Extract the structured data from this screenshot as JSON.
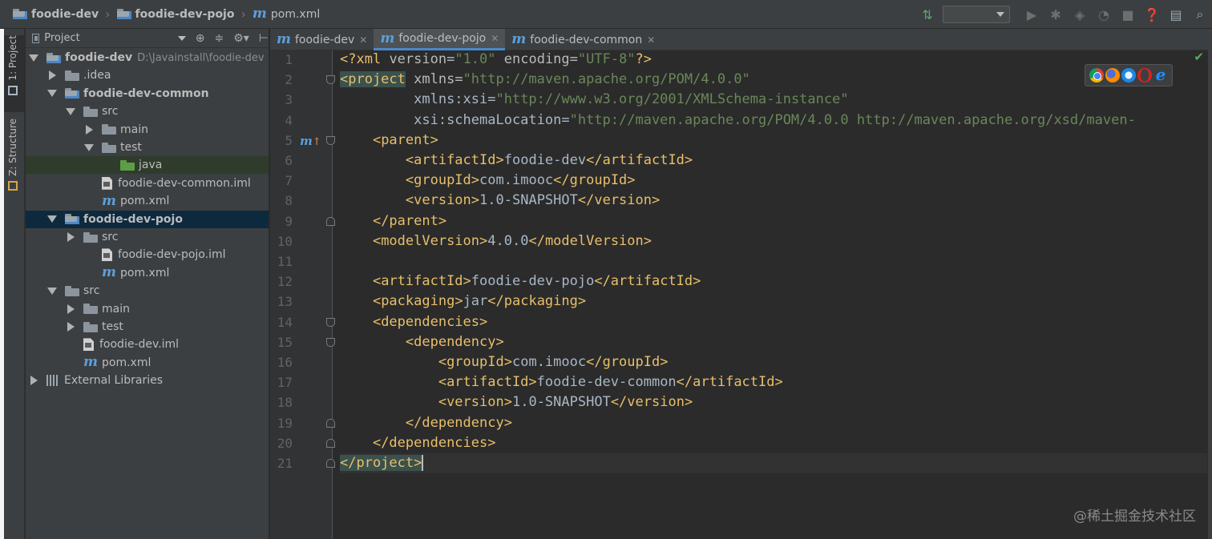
{
  "breadcrumbs": [
    "foodie-dev",
    "foodie-dev-pojo",
    "pom.xml"
  ],
  "project_panel": {
    "title": "Project",
    "tree": [
      {
        "label": "foodie-dev",
        "path": "D:\\Javainstall\\foodie-dev",
        "depth": 0,
        "expand": "down",
        "icon": "module-folder-icon",
        "bold": true
      },
      {
        "label": ".idea",
        "depth": 1,
        "expand": "right",
        "icon": "folder-icon"
      },
      {
        "label": "foodie-dev-common",
        "depth": 1,
        "expand": "down",
        "icon": "module-folder-icon",
        "bold": true
      },
      {
        "label": "src",
        "depth": 2,
        "expand": "down",
        "icon": "folder-icon"
      },
      {
        "label": "main",
        "depth": 3,
        "expand": "right",
        "icon": "folder-icon"
      },
      {
        "label": "test",
        "depth": 3,
        "expand": "down",
        "icon": "folder-icon"
      },
      {
        "label": "java",
        "depth": 4,
        "expand": "none",
        "icon": "test-folder-icon",
        "highlight": true
      },
      {
        "label": "foodie-dev-common.iml",
        "depth": 3,
        "expand": "none",
        "icon": "iml-file-icon"
      },
      {
        "label": "pom.xml",
        "depth": 3,
        "expand": "none",
        "icon": "maven-icon"
      },
      {
        "label": "foodie-dev-pojo",
        "depth": 1,
        "expand": "down",
        "icon": "module-folder-icon",
        "bold": true,
        "selected": true
      },
      {
        "label": "src",
        "depth": 2,
        "expand": "right",
        "icon": "folder-icon"
      },
      {
        "label": "foodie-dev-pojo.iml",
        "depth": 3,
        "expand": "none",
        "icon": "iml-file-icon"
      },
      {
        "label": "pom.xml",
        "depth": 3,
        "expand": "none",
        "icon": "maven-icon"
      },
      {
        "label": "src",
        "depth": 1,
        "expand": "down",
        "icon": "folder-icon"
      },
      {
        "label": "main",
        "depth": 2,
        "expand": "right",
        "icon": "folder-icon"
      },
      {
        "label": "test",
        "depth": 2,
        "expand": "right",
        "icon": "folder-icon"
      },
      {
        "label": "foodie-dev.iml",
        "depth": 2,
        "expand": "none",
        "icon": "iml-file-icon"
      },
      {
        "label": "pom.xml",
        "depth": 2,
        "expand": "none",
        "icon": "maven-icon"
      },
      {
        "label": "External Libraries",
        "depth": 0,
        "expand": "right",
        "icon": "library-icon"
      }
    ]
  },
  "stripe": {
    "project_label": "1: Project",
    "structure_label": "Z: Structure"
  },
  "tabs": [
    {
      "label": "foodie-dev",
      "active": false
    },
    {
      "label": "foodie-dev-pojo",
      "active": true
    },
    {
      "label": "foodie-dev-common",
      "active": false
    }
  ],
  "editor": {
    "line_numbers": [
      "1",
      "2",
      "3",
      "4",
      "5",
      "6",
      "7",
      "8",
      "9",
      "10",
      "11",
      "12",
      "13",
      "14",
      "15",
      "16",
      "17",
      "18",
      "19",
      "20",
      "21"
    ],
    "lines": [
      "<?xml version=\"1.0\" encoding=\"UTF-8\"?>",
      "<project xmlns=\"http://maven.apache.org/POM/4.0.0\"",
      "         xmlns:xsi=\"http://www.w3.org/2001/XMLSchema-instance\"",
      "         xsi:schemaLocation=\"http://maven.apache.org/POM/4.0.0 http://maven.apache.org/xsd/maven-",
      "    <parent>",
      "        <artifactId>foodie-dev</artifactId>",
      "        <groupId>com.imooc</groupId>",
      "        <version>1.0-SNAPSHOT</version>",
      "    </parent>",
      "    <modelVersion>4.0.0</modelVersion>",
      "",
      "    <artifactId>foodie-dev-pojo</artifactId>",
      "    <packaging>jar</packaging>",
      "    <dependencies>",
      "        <dependency>",
      "            <groupId>com.imooc</groupId>",
      "            <artifactId>foodie-dev-common</artifactId>",
      "            <version>1.0-SNAPSHOT</version>",
      "        </dependency>",
      "    </dependencies>",
      "</project>"
    ]
  },
  "watermark": "@稀土掘金技术社区",
  "colors": {
    "tag": "#e8bf6a",
    "attr_value": "#6a8759",
    "namespace": "#9876aa",
    "text": "#a9b7c6",
    "selection": "#0d293e",
    "accent": "#4a88c7"
  }
}
